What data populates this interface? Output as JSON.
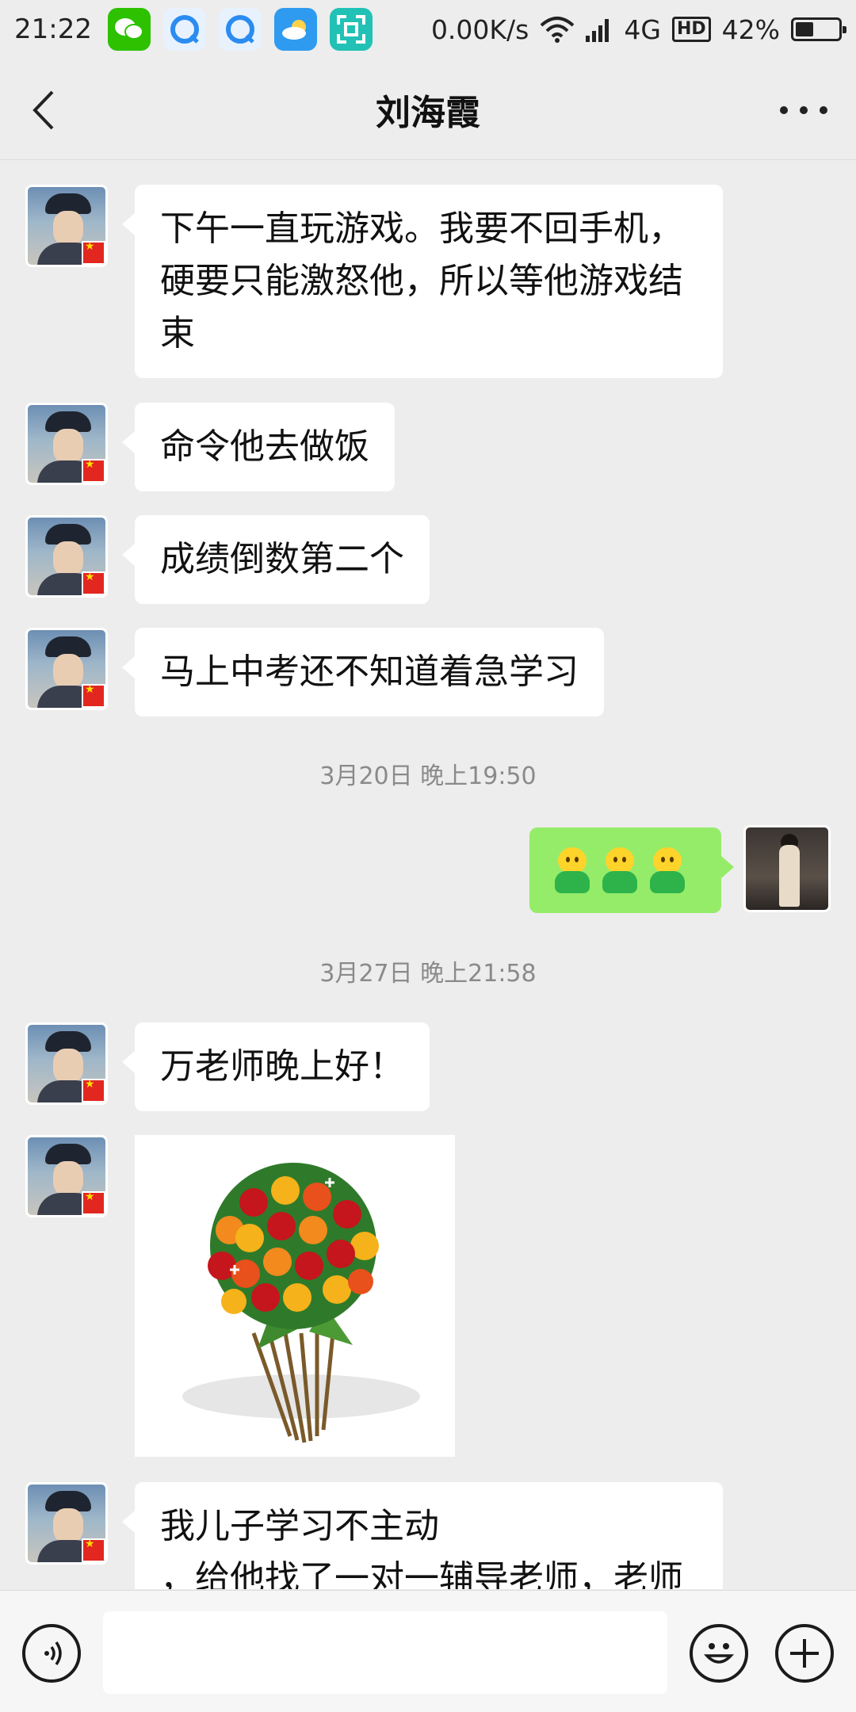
{
  "status_bar": {
    "time": "21:22",
    "network_speed": "0.00K/s",
    "network_type": "4G",
    "hd_label": "HD",
    "battery_percent": "42%",
    "battery_level": 0.42,
    "notification_icons": [
      "wechat-icon",
      "browser-icon",
      "browser-icon",
      "weather-icon",
      "scanner-icon"
    ]
  },
  "header": {
    "title": "刘海霞"
  },
  "messages": [
    {
      "side": "left",
      "text": "下午一直玩游戏。我要不回手机，硬要只能激怒他，所以等他游戏结束"
    },
    {
      "side": "left",
      "text": "命令他去做饭"
    },
    {
      "side": "left",
      "text": "成绩倒数第二个"
    },
    {
      "side": "left",
      "text": "马上中考还不知道着急学习"
    },
    {
      "timestamp": "3月20日 晚上19:50"
    },
    {
      "side": "right",
      "emoji": [
        "person-emoji",
        "person-emoji",
        "person-emoji"
      ]
    },
    {
      "timestamp": "3月27日 晚上21:58"
    },
    {
      "side": "left",
      "text": "万老师晚上好！"
    },
    {
      "side": "left",
      "image": "flower-bouquet"
    },
    {
      "side": "left",
      "text": "我儿子学习不主动\n，给他找了一对一辅导老师，老师"
    }
  ],
  "colors": {
    "background": "#ededed",
    "bubble_left": "#ffffff",
    "bubble_right": "#95ec69",
    "timestamp_text": "#8a8a8a"
  }
}
